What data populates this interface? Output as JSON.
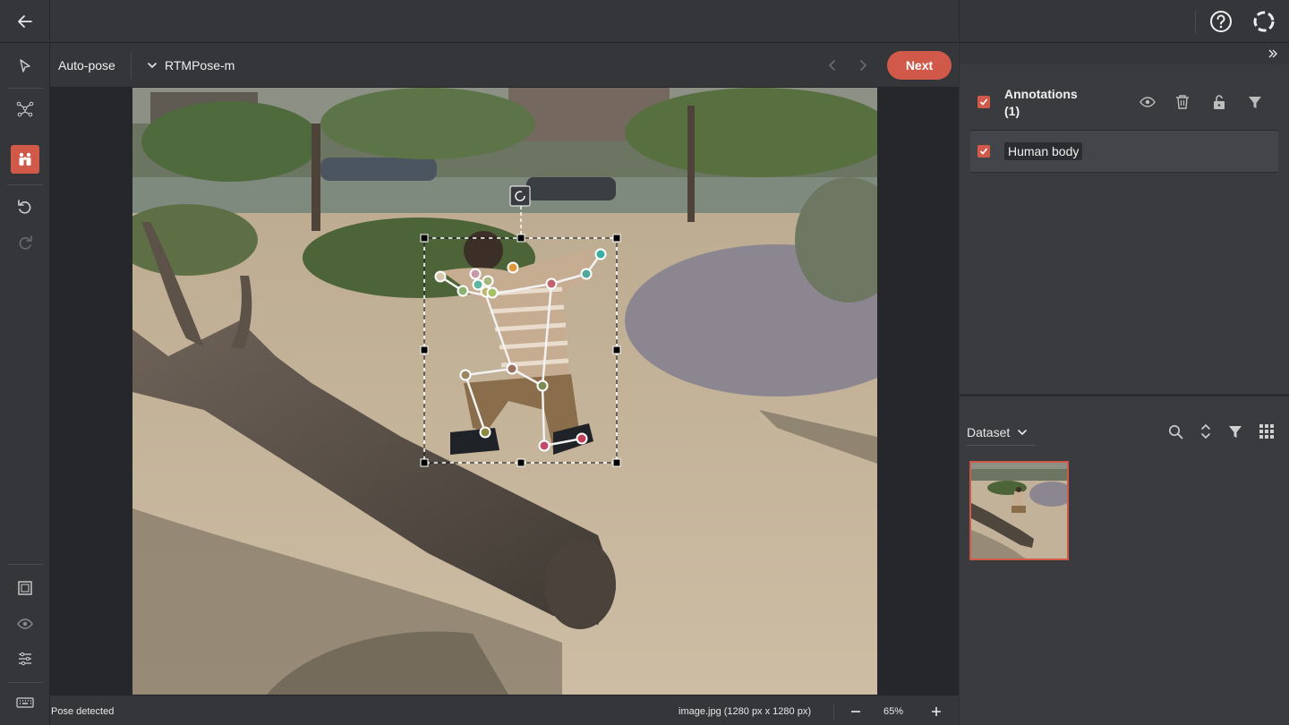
{
  "toolbar": {
    "mode_label": "Auto-pose",
    "model": "RTMPose-m",
    "next_label": "Next"
  },
  "left_tools": [
    {
      "name": "select-tool",
      "icon": "cursor-arrow-icon"
    },
    {
      "name": "skeleton-tool",
      "icon": "keypoint-graph-icon"
    },
    {
      "name": "auto-pose-tool",
      "icon": "people-icon",
      "active": true
    },
    {
      "name": "undo-button",
      "icon": "undo-icon"
    },
    {
      "name": "redo-button",
      "icon": "redo-icon"
    },
    {
      "name": "fit-to-screen-button",
      "icon": "fit-screen-icon"
    },
    {
      "name": "visibility-button",
      "icon": "eye-icon"
    },
    {
      "name": "adjustments-button",
      "icon": "sliders-icon"
    },
    {
      "name": "shortcuts-button",
      "icon": "keyboard-icon"
    }
  ],
  "annotations": {
    "title": "Annotations",
    "count": "(1)",
    "items": [
      {
        "label": "Human body"
      }
    ]
  },
  "dataset": {
    "label": "Dataset"
  },
  "status": {
    "message": "Pose detected",
    "file_info": "image.jpg (1280 px x 1280 px)",
    "zoom": "65%"
  },
  "colors": {
    "accent": "#d0594a",
    "panel": "#3a3b3f",
    "toolbar": "#35363a"
  }
}
